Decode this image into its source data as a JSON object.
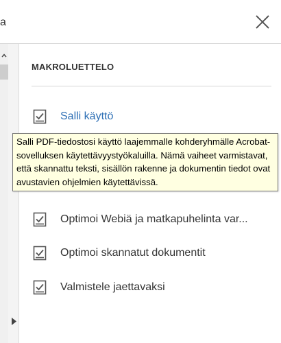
{
  "header": {
    "title_fragment": "a",
    "close_icon": "close-icon"
  },
  "panel": {
    "heading": "MAKROLUETTELO",
    "actions": [
      {
        "label": "Salli käyttö",
        "icon": "checklist-icon"
      },
      {
        "label": "Optimoi Webiä ja matkapuhelinta var...",
        "icon": "checklist-icon"
      },
      {
        "label": "Optimoi skannatut dokumentit",
        "icon": "checklist-icon"
      },
      {
        "label": "Valmistele jaettavaksi",
        "icon": "checklist-icon"
      }
    ]
  },
  "tooltip": {
    "text": "Salli PDF-tiedostosi käyttö laajemmalle kohderyhmälle Acrobat-sovelluksen käytettävyystyökaluilla. Nämä vaiheet varmistavat, että skannattu teksti, sisällön rakenne ja dokumentin tiedot ovat avustavien ohjelmien käytettävissä."
  },
  "colors": {
    "link": "#2d6fb5",
    "tooltip_bg": "#ffffe1",
    "text": "#333333"
  }
}
